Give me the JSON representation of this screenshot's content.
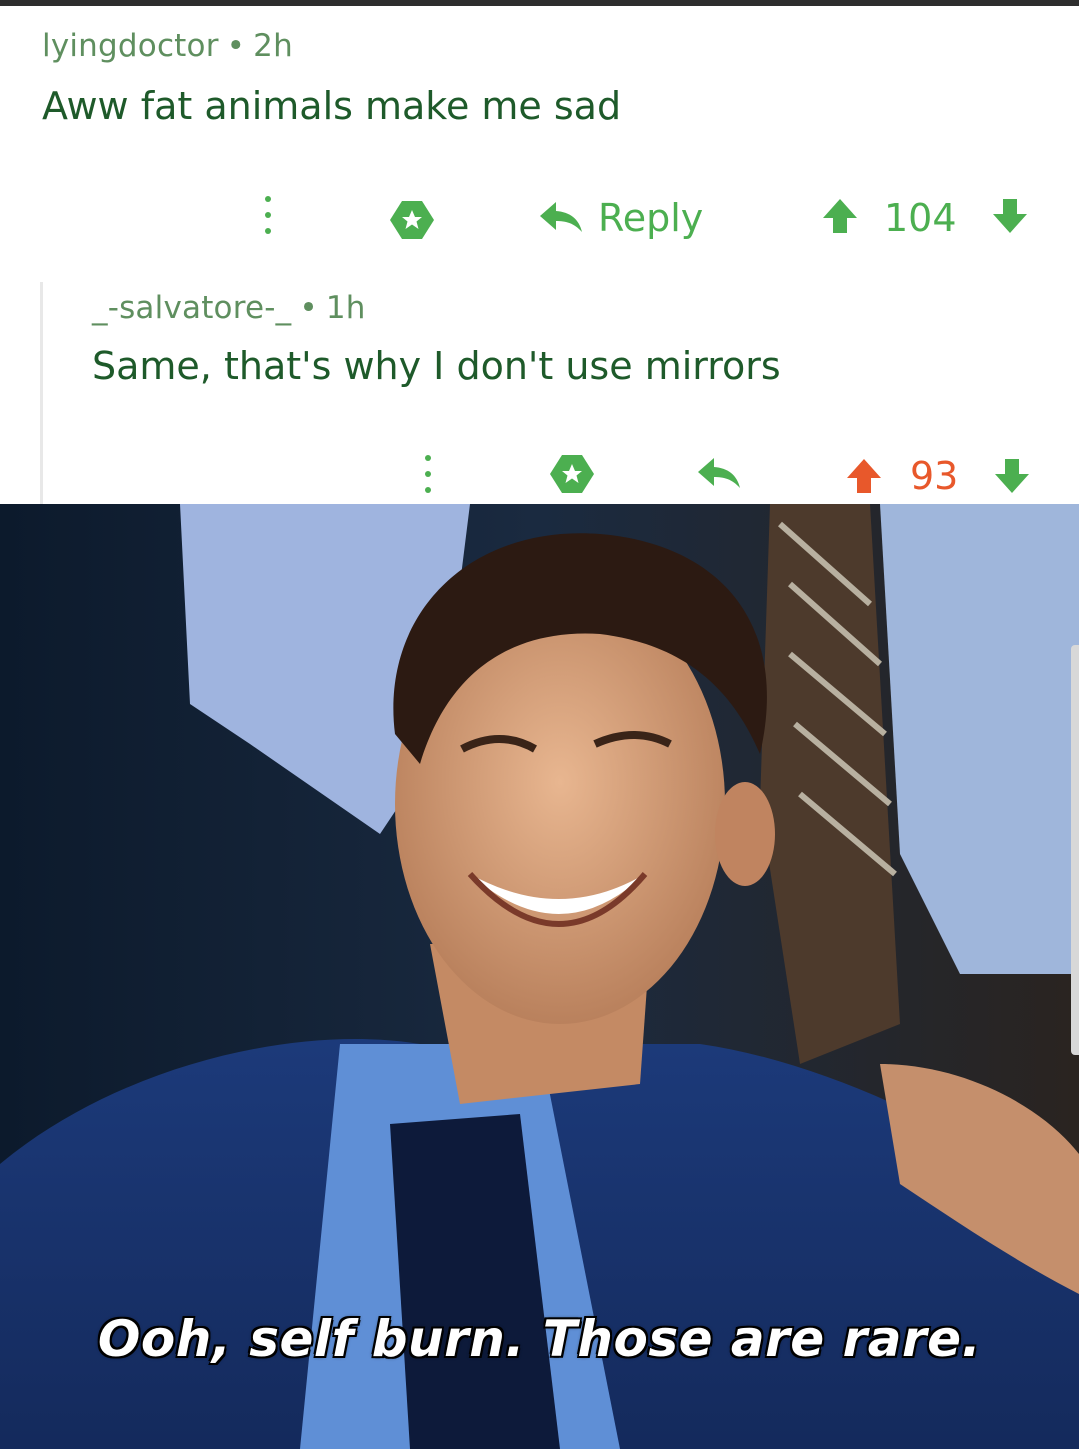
{
  "comments": [
    {
      "username": "lyingdoctor",
      "age": "2h",
      "text": "Aww fat animals make me sad",
      "reply_label": "Reply",
      "score": "104"
    },
    {
      "username": "_-salvatore-_",
      "age": "1h",
      "text": "Same, that's why I don't use mirrors",
      "score": "93"
    }
  ],
  "separator": "•",
  "meme": {
    "caption": "Ooh, self burn. Those are rare."
  },
  "colors": {
    "green": "#4caf50",
    "dark_green": "#1e5a2a",
    "upvoted_orange": "#e8582b"
  },
  "icons": [
    "more-options-icon",
    "award-icon",
    "reply-icon",
    "upvote-icon",
    "downvote-icon"
  ]
}
